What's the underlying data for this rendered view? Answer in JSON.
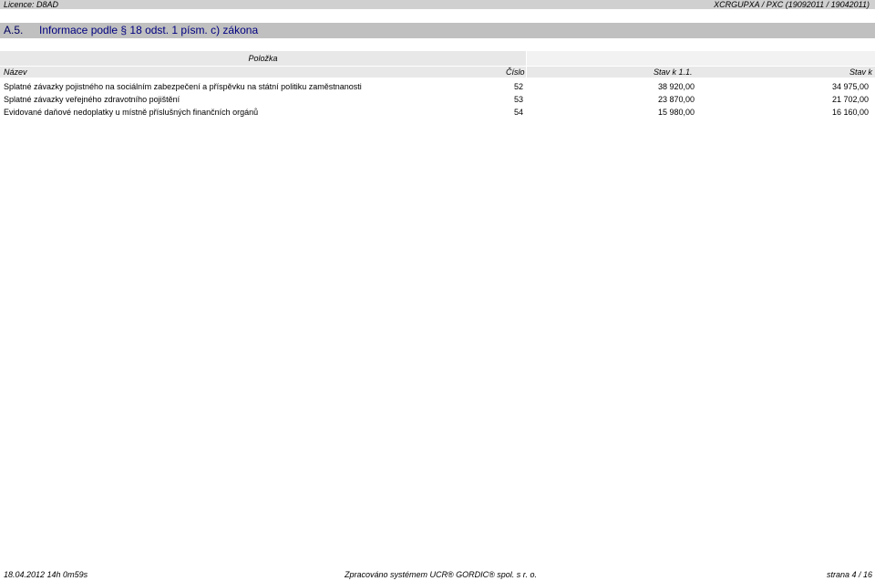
{
  "header": {
    "licence": "Licence: D8AD",
    "report_code": "XCRGUPXA / PXC  (19092011 / 19042011)"
  },
  "section": {
    "number": "A.5.",
    "title": "Informace podle § 18 odst. 1 písm. c) zákona"
  },
  "table": {
    "group_header": "Položka",
    "columns": {
      "name": "Název",
      "number": "Číslo",
      "stav1": "Stav k 1.1.",
      "stav2": "Stav k"
    },
    "rows": [
      {
        "name": "Splatné závazky pojistného na sociálním zabezpečení a příspěvku na státní politiku zaměstnanosti",
        "number": "52",
        "stav1": "38 920,00",
        "stav2": "34 975,00"
      },
      {
        "name": "Splatné závazky veřejného zdravotního pojištění",
        "number": "53",
        "stav1": "23 870,00",
        "stav2": "21 702,00"
      },
      {
        "name": "Evidované daňové nedoplatky u místně příslušných finančních orgánů",
        "number": "54",
        "stav1": "15 980,00",
        "stav2": "16 160,00"
      }
    ]
  },
  "footer": {
    "timestamp": "18.04.2012 14h 0m59s",
    "processed_by": "Zpracováno systémem UCR® GORDIC® spol. s  r. o.",
    "page": "strana 4 / 16"
  }
}
